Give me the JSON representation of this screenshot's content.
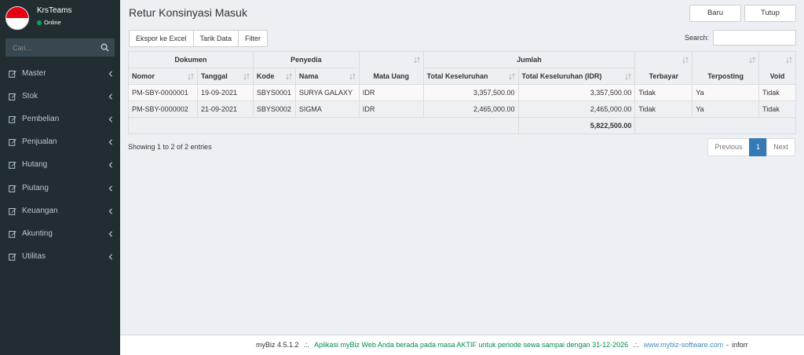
{
  "sidebar": {
    "user_name": "KrsTeams",
    "user_status": "Online",
    "search_placeholder": "Cari...",
    "items": [
      {
        "label": "Master"
      },
      {
        "label": "Stok"
      },
      {
        "label": "Pembelian"
      },
      {
        "label": "Penjualan"
      },
      {
        "label": "Hutang"
      },
      {
        "label": "Piutang"
      },
      {
        "label": "Keuangan"
      },
      {
        "label": "Akunting"
      },
      {
        "label": "Utilitas"
      }
    ]
  },
  "header": {
    "title": "Retur Konsinyasi Masuk",
    "btn_baru": "Baru",
    "btn_tutup": "Tutup"
  },
  "toolbar": {
    "export_label": "Ekspor ke Excel",
    "pull_label": "Tarik Data",
    "filter_label": "Filter",
    "search_label": "Search:",
    "search_value": ""
  },
  "table": {
    "group_headers": {
      "dokumen": "Dokumen",
      "penyedia": "Penyedia",
      "jumlah": "Jumlah"
    },
    "columns": {
      "nomor": "Nomor",
      "tanggal": "Tanggal",
      "kode": "Kode",
      "nama": "Nama",
      "mata_uang": "Mata Uang",
      "total": "Total Keseluruhan",
      "total_idr": "Total Keseluruhan (IDR)",
      "terbayar": "Terbayar",
      "terposting": "Terposting",
      "void": "Void"
    },
    "rows": [
      {
        "nomor": "PM-SBY-0000001",
        "tanggal": "19-09-2021",
        "kode": "SBYS0001",
        "nama": "SURYA GALAXY",
        "mata_uang": "IDR",
        "total": "3,357,500.00",
        "total_idr": "3,357,500.00",
        "terbayar": "Tidak",
        "terposting": "Ya",
        "void": "Tidak"
      },
      {
        "nomor": "PM-SBY-0000002",
        "tanggal": "21-09-2021",
        "kode": "SBYS0002",
        "nama": "SIGMA",
        "mata_uang": "IDR",
        "total": "2,465,000.00",
        "total_idr": "2,465,000.00",
        "terbayar": "Tidak",
        "terposting": "Ya",
        "void": "Tidak"
      }
    ],
    "grand_total": "5,822,500.00"
  },
  "info": "Showing 1 to 2 of 2 entries",
  "pagination": {
    "previous": "Previous",
    "current": "1",
    "next": "Next"
  },
  "footer": {
    "version": "myBiz 4.5.1.2",
    "separator": ".:.",
    "message": "Aplikasi myBiz Web Anda berada pada masa AKTIF untuk periode sewa sampai dengan 31-12-2026",
    "link": "www.mybiz-software.com",
    "dash": "-",
    "trailing": "inforr"
  }
}
